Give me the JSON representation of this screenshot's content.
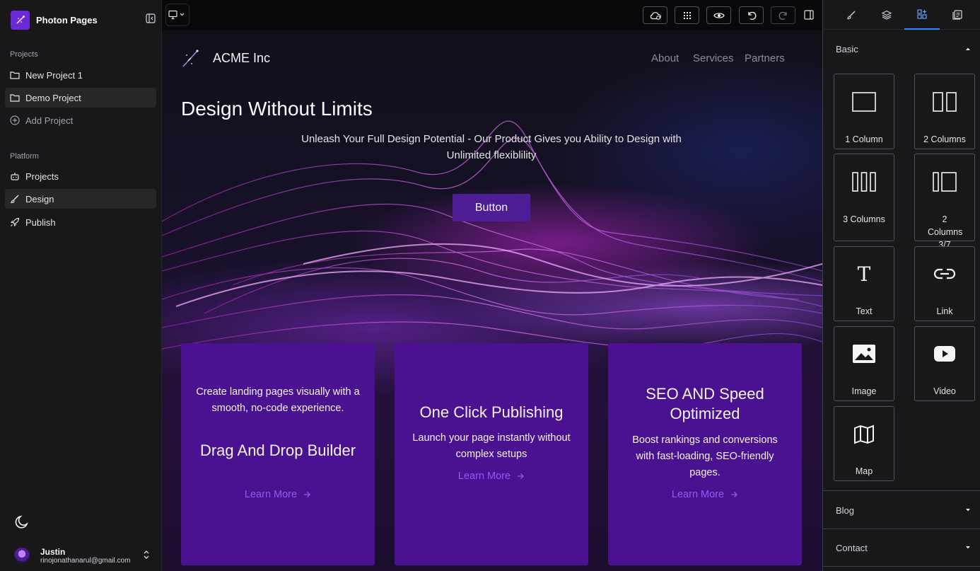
{
  "sidebar": {
    "app_name": "Photon Pages",
    "projects_label": "Projects",
    "projects": [
      {
        "label": "New Project 1"
      },
      {
        "label": "Demo Project"
      }
    ],
    "add_project": "Add Project",
    "platform_label": "Platform",
    "platform": [
      {
        "label": "Projects"
      },
      {
        "label": "Design"
      },
      {
        "label": "Publish"
      }
    ],
    "user": {
      "name": "Justin",
      "email": "rinojonathanarul@gmail.com"
    }
  },
  "canvas": {
    "site_name": "ACME Inc",
    "nav": [
      "About",
      "Services",
      "Partners"
    ],
    "hero_title": "Design Without Limits",
    "hero_subtitle": "Unleash Your Full Design Potential -  Our Product Gives you Ability to Design with Unlimited flexiblility",
    "hero_button": "Button",
    "cards": [
      {
        "description": "Create landing pages visually with a smooth, no-code experience.",
        "title": "Drag And Drop Builder",
        "link": "Learn More"
      },
      {
        "title": "One Click Publishing",
        "description": "Launch your page instantly without complex setups",
        "link": "Learn More"
      },
      {
        "title": "SEO AND Speed Optimized",
        "description": "Boost rankings and conversions with fast-loading, SEO-friendly pages.",
        "link": "Learn More"
      }
    ]
  },
  "right_panel": {
    "basic_label": "Basic",
    "blocks": [
      {
        "label": "1 Column",
        "icon": "one-column-icon"
      },
      {
        "label": "2 Columns",
        "icon": "two-columns-icon"
      },
      {
        "label": "3 Columns",
        "icon": "three-columns-icon"
      },
      {
        "label": "2 Columns 3/7",
        "icon": "two-columns-3-7-icon"
      },
      {
        "label": "Text",
        "icon": "text-icon"
      },
      {
        "label": "Link",
        "icon": "link-icon"
      },
      {
        "label": "Image",
        "icon": "image-icon"
      },
      {
        "label": "Video",
        "icon": "video-icon"
      },
      {
        "label": "Map",
        "icon": "map-icon"
      }
    ],
    "blog_label": "Blog",
    "contact_label": "Contact"
  },
  "colors": {
    "accent": "#6d28d9",
    "card": "#4a1190",
    "link": "#8b5cf6",
    "tab_active": "#3b82f6"
  }
}
